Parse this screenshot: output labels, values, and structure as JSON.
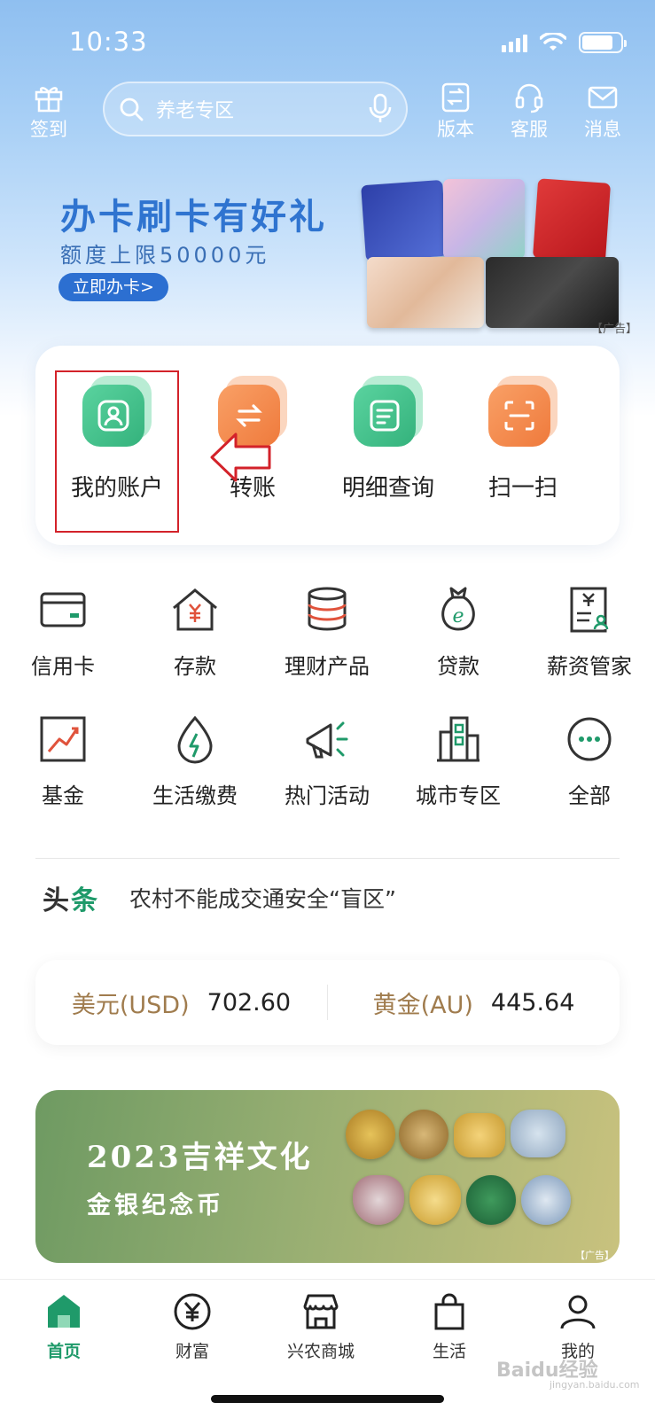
{
  "status_bar": {
    "time": "10:33"
  },
  "top_nav": {
    "checkin_label": "签到",
    "search_placeholder": "养老专区",
    "version_label": "版本",
    "service_label": "客服",
    "message_label": "消息"
  },
  "banner": {
    "title": "办卡刷卡有好礼",
    "subtitle": "额度上限50000元",
    "cta": "立即办卡>",
    "ad_tag": "【广告】"
  },
  "quick_actions": [
    {
      "label": "我的账户",
      "icon": "user-account-icon",
      "color": "#3cc08a"
    },
    {
      "label": "转账",
      "icon": "transfer-icon",
      "color": "#f2874d"
    },
    {
      "label": "明细查询",
      "icon": "statement-icon",
      "color": "#3cc08a"
    },
    {
      "label": "扫一扫",
      "icon": "scan-icon",
      "color": "#f2874d"
    }
  ],
  "services": [
    {
      "label": "信用卡",
      "icon": "credit-card-icon"
    },
    {
      "label": "存款",
      "icon": "deposit-icon"
    },
    {
      "label": "理财产品",
      "icon": "wealth-product-icon"
    },
    {
      "label": "贷款",
      "icon": "loan-icon"
    },
    {
      "label": "薪资管家",
      "icon": "salary-icon"
    },
    {
      "label": "基金",
      "icon": "fund-icon"
    },
    {
      "label": "生活缴费",
      "icon": "utility-payment-icon"
    },
    {
      "label": "热门活动",
      "icon": "megaphone-icon"
    },
    {
      "label": "城市专区",
      "icon": "city-icon"
    },
    {
      "label": "全部",
      "icon": "more-icon"
    }
  ],
  "headline": {
    "tag_part1": "头",
    "tag_part2": "条",
    "text": "农村不能成交通安全“盲区”"
  },
  "rates": [
    {
      "name": "美元(USD)",
      "value": "702.60"
    },
    {
      "name": "黄金(AU)",
      "value": "445.64"
    }
  ],
  "promo": {
    "line1": "2023吉祥文化",
    "line2": "金银纪念币",
    "ad_tag": "【广告】"
  },
  "tabs": [
    {
      "label": "首页",
      "icon": "home-icon",
      "active": true
    },
    {
      "label": "财富",
      "icon": "yuan-circle-icon"
    },
    {
      "label": "兴农商城",
      "icon": "shop-icon"
    },
    {
      "label": "生活",
      "icon": "shopping-bag-icon"
    },
    {
      "label": "我的",
      "icon": "profile-icon"
    }
  ],
  "watermark": {
    "main": "Baidu经验",
    "sub": "jingyan.baidu.com"
  },
  "colors": {
    "brand_green": "#1f9a6a",
    "accent_orange": "#f2874d",
    "highlight_red": "#d3222a",
    "banner_blue": "#2f74d0"
  }
}
